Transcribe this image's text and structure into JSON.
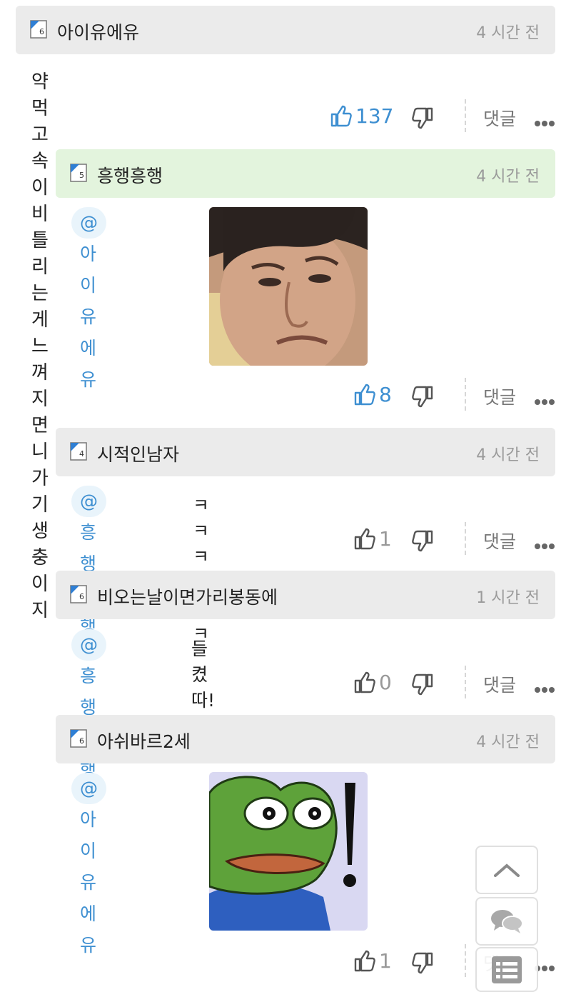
{
  "comments": [
    {
      "user": "아이유에유",
      "level": "6",
      "time": "4 시간 전",
      "text": "약먹고 속이 비틀리는게 느껴지면 니가 기생충이지",
      "likes": "137",
      "reply": "댓글"
    },
    {
      "user": "흥행흥행",
      "level": "5",
      "time": "4 시간 전",
      "mention": "@아이유에유",
      "sticker": "man-face-sticker",
      "likes": "8",
      "reply": "댓글"
    },
    {
      "user": "시적인남자",
      "level": "4",
      "time": "4 시간 전",
      "mention": "@흥행흥행",
      "text": "ㅋㅋㅋㅋㅋㅋ",
      "likes": "1",
      "reply": "댓글"
    },
    {
      "user": "비오는날이면가리봉동에",
      "level": "6",
      "time": "1 시간 전",
      "mention": "@흥행흥행",
      "text": "들켰따!",
      "likes": "0",
      "reply": "댓글"
    },
    {
      "user": "아쉬바르2세",
      "level": "6",
      "time": "4 시간 전",
      "mention": "@아이유에유",
      "sticker": "pepe-frog-sticker",
      "likes": "1",
      "reply": "댓글"
    }
  ],
  "colors": {
    "accent": "#3e8fd1",
    "green_header": "#e3f4dd",
    "gray_header": "#ebebeb"
  },
  "floating": {
    "top": "chevron-up-icon",
    "chat": "chat-bubbles-icon",
    "list": "list-icon"
  }
}
